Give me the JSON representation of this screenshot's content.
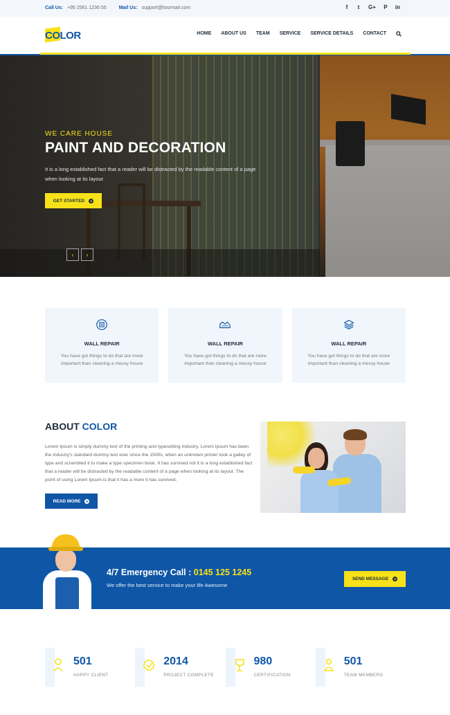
{
  "topbar": {
    "call_label": "Call Us:",
    "call_value": "+95 2561 1236 55",
    "mail_label": "Mail Us:",
    "mail_value": "support@tourmail.com",
    "social": [
      "f",
      "t",
      "G+",
      "P",
      "in"
    ]
  },
  "brand": {
    "logo_text": "COLOR",
    "colors": {
      "primary": "#0f56a6",
      "accent": "#f7e21a"
    }
  },
  "nav": {
    "items": [
      "HOME",
      "ABOUT US",
      "TEAM",
      "SERVICE",
      "SERVICE DETAILS",
      "CONTACT"
    ]
  },
  "hero": {
    "subtitle": "WE CARE HOUSE",
    "title": "PAINT AND DECORATION",
    "description": "It is a long established fact that a reader will be distracted by the readable content of a page when looking at its layout",
    "cta": "GET STARTED"
  },
  "features": [
    {
      "icon": "wall-repair-icon",
      "title": "WALL REPAIR",
      "text": "You have got things to do that are more important than cleaning a messy house"
    },
    {
      "icon": "wall-repair-icon",
      "title": "WALL REPAIR",
      "text": "You have got things to do that are more important than cleaning a messy house"
    },
    {
      "icon": "wall-repair-icon",
      "title": "WALL REPAIR",
      "text": "You have got things to do that are more important than cleaning a messy house"
    }
  ],
  "about": {
    "title_prefix": "ABOUT",
    "title_accent": "COLOR",
    "text": "Lorem Ipsum is simply dummy text of the printing and typesetting industry. Lorem Ipsum has been the industry's standard dummy text ever since the 1500s, when an unknown printer took a galley of type and scrambled it to make a type specimen book. It has survived not it is a long established fact that a reader will be distracted by the readable content of a page when looking at its layout. The point of using Lorem Ipsum is that it has a more it has survived.",
    "button": "READ MORE"
  },
  "emergency": {
    "title_prefix": "4/7 Emergency Call :",
    "phone": "0145 125 1245",
    "subtitle": "We offer the best service to make your life Awesome",
    "button": "SEND MESSAGE"
  },
  "stats": [
    {
      "icon": "happy-client-icon",
      "value": "501",
      "label": "HAPPY CLIENT"
    },
    {
      "icon": "project-icon",
      "value": "2014",
      "label": "PROJECT COMPLETE"
    },
    {
      "icon": "certification-icon",
      "value": "980",
      "label": "CERTIFICATION"
    },
    {
      "icon": "team-icon",
      "value": "501",
      "label": "TEAM MEMBERS"
    }
  ]
}
